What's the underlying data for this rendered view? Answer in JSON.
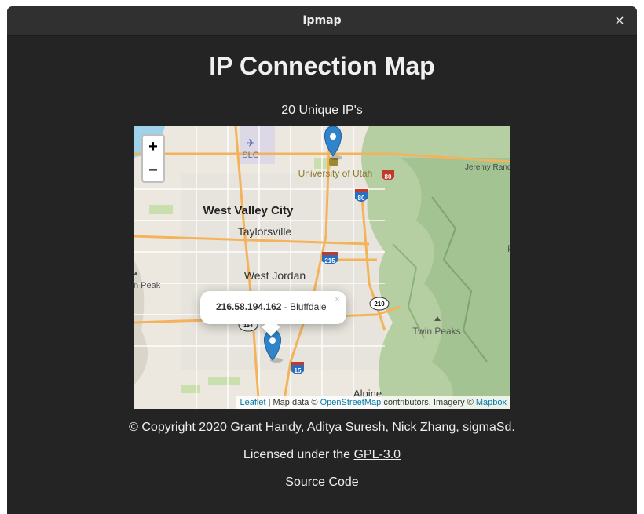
{
  "window": {
    "title": "Ipmap",
    "close_glyph": "×"
  },
  "page": {
    "title": "IP Connection Map",
    "unique_count": "20 Unique IP's"
  },
  "map": {
    "zoom_in": "+",
    "zoom_out": "−",
    "labels": {
      "slc": "SLC",
      "university": "University of Utah",
      "jeremy": "Jeremy Ranc",
      "west_valley": "West Valley City",
      "taylorsville": "Taylorsville",
      "west_jordan": "West Jordan",
      "peak_left": "n Peak",
      "twin_peaks": "Twin Peaks",
      "alpine": "Alpine",
      "edge_p": "P"
    },
    "shields": {
      "i80_a": "80",
      "i80_b": "80",
      "i215": "215",
      "i15": "15",
      "sr210": "210",
      "sr154": "154"
    },
    "popup": {
      "ip": "216.58.194.162",
      "separator": " - ",
      "place": "Bluffdale",
      "close": "×"
    },
    "attribution": {
      "leaflet": "Leaflet",
      "sep1": " | Map data © ",
      "osm": "OpenStreetMap",
      "sep2": " contributors, Imagery © ",
      "mapbox": "Mapbox"
    },
    "colors": {
      "marker": "#2f84cb",
      "interstate": "#c0392b",
      "road_major": "#f4b35a",
      "terrain": "#9fbf8e"
    }
  },
  "footer": {
    "copyright": "© Copyright 2020 Grant Handy, Aditya Suresh, Nick Zhang, sigmaSd.",
    "license_prefix": "Licensed under the ",
    "license_link": "GPL-3.0",
    "source_link": "Source Code"
  }
}
